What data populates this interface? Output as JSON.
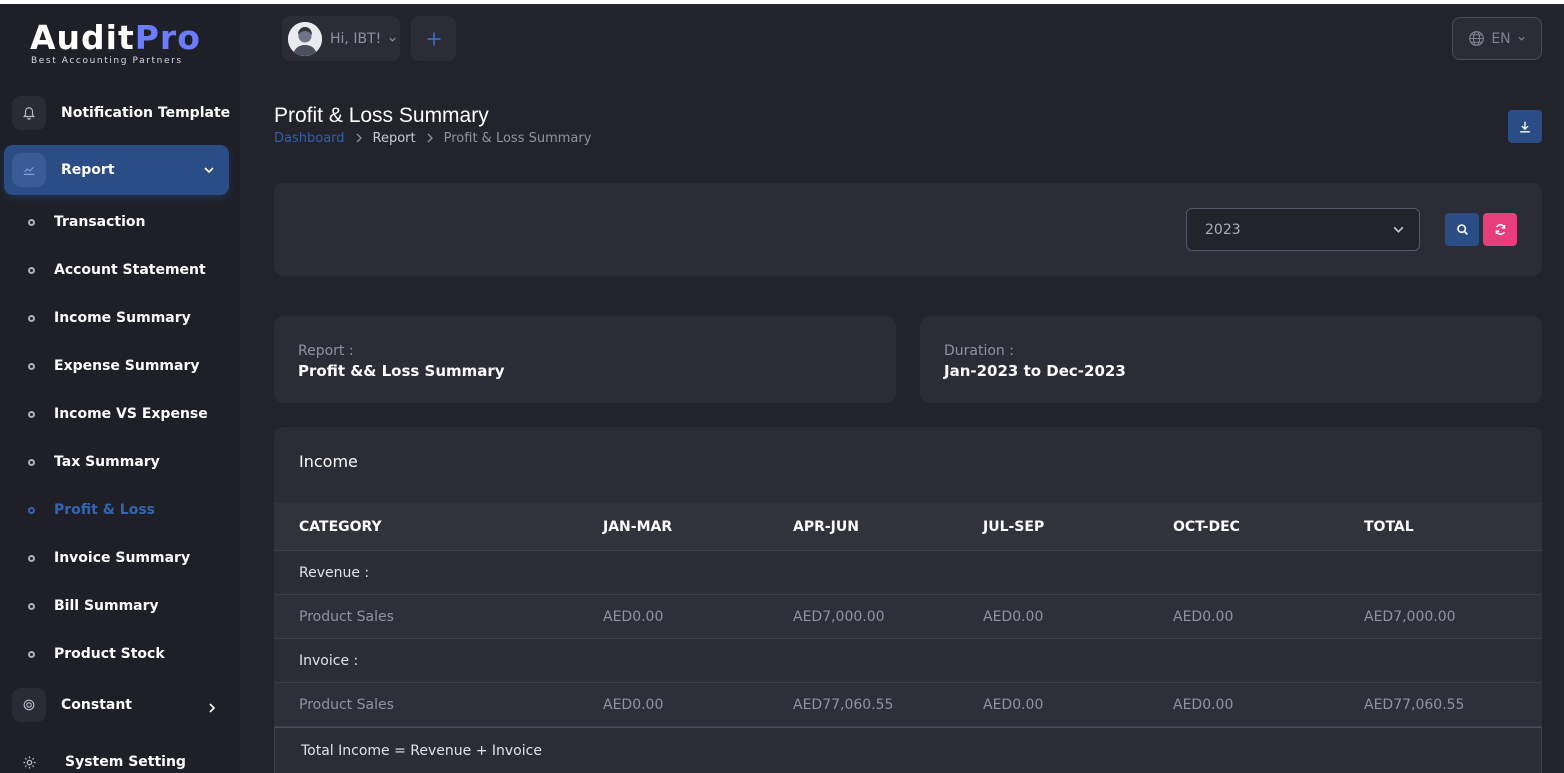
{
  "brand": {
    "name_a": "Audit",
    "name_b": "Pro",
    "tagline": "Best Accounting Partners",
    "accent": "#6b7cff"
  },
  "sidebar": {
    "top_items": [
      {
        "label": "Notification Template",
        "icon": "bell-icon"
      },
      {
        "label": "Report",
        "icon": "chart-icon"
      },
      {
        "label": "Constant",
        "icon": "constant-icon"
      },
      {
        "label": "System Setting",
        "icon": "gear-icon"
      }
    ],
    "report_subitems": [
      {
        "label": "Transaction"
      },
      {
        "label": "Account Statement"
      },
      {
        "label": "Income Summary"
      },
      {
        "label": "Expense Summary"
      },
      {
        "label": "Income VS Expense"
      },
      {
        "label": "Tax Summary"
      },
      {
        "label": "Profit & Loss",
        "active": true
      },
      {
        "label": "Invoice Summary"
      },
      {
        "label": "Bill Summary"
      },
      {
        "label": "Product Stock"
      }
    ]
  },
  "header": {
    "greeting": "Hi, IBT!",
    "language": "EN"
  },
  "page": {
    "title": "Profit & Loss Summary",
    "breadcrumb": [
      "Dashboard",
      "Report",
      "Profit & Loss Summary"
    ]
  },
  "filter": {
    "year": "2023"
  },
  "info": {
    "report_label": "Report :",
    "report_value": "Profit && Loss Summary",
    "duration_label": "Duration :",
    "duration_value": "Jan-2023 to Dec-2023"
  },
  "income": {
    "title": "Income",
    "columns": [
      "CATEGORY",
      "JAN-MAR",
      "APR-JUN",
      "JUL-SEP",
      "OCT-DEC",
      "TOTAL"
    ],
    "groups": [
      {
        "name": "Revenue :",
        "rows": [
          [
            "Product Sales",
            "AED0.00",
            "AED7,000.00",
            "AED0.00",
            "AED0.00",
            "AED7,000.00"
          ]
        ]
      },
      {
        "name": "Invoice :",
        "rows": [
          [
            "Product Sales",
            "AED0.00",
            "AED77,060.55",
            "AED0.00",
            "AED0.00",
            "AED77,060.55"
          ]
        ]
      }
    ],
    "total_label": "Total Income = Revenue + Invoice"
  },
  "colors": {
    "primary": "#2b4d86",
    "danger": "#e83e7c",
    "active_link": "#3464b4"
  }
}
